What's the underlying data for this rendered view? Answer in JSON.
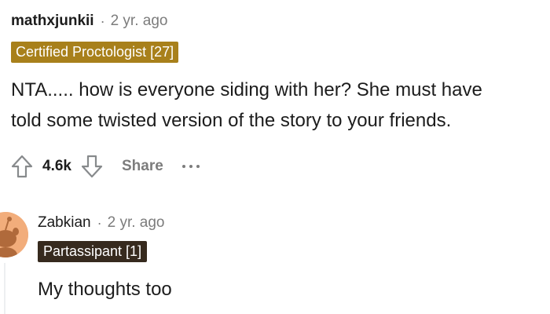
{
  "comment": {
    "author": "mathxjunkii",
    "separator": "·",
    "age": "2 yr. ago",
    "flair": "Certified Proctologist [27]",
    "body_lines": [
      "NTA..... how is everyone siding with her? She must have",
      "told some twisted version of the story to your friends."
    ],
    "actions": {
      "upvote_icon": "arrow-up-icon",
      "score": "4.6k",
      "downvote_icon": "arrow-down-icon",
      "share_label": "Share",
      "more_icon": "ellipsis-icon"
    },
    "colors": {
      "flair_bg": "#a8801b",
      "meta_gray": "#7c7c7c",
      "text": "#1c1c1c"
    }
  },
  "reply": {
    "author": "Zabkian",
    "separator": "·",
    "age": "2 yr. ago",
    "flair": "Partassipant [1]",
    "body": "My thoughts too",
    "avatar_icon": "snoo-avatar-icon",
    "colors": {
      "flair_bg": "#362a1e",
      "avatar_bg": "#f2ad7b"
    }
  }
}
